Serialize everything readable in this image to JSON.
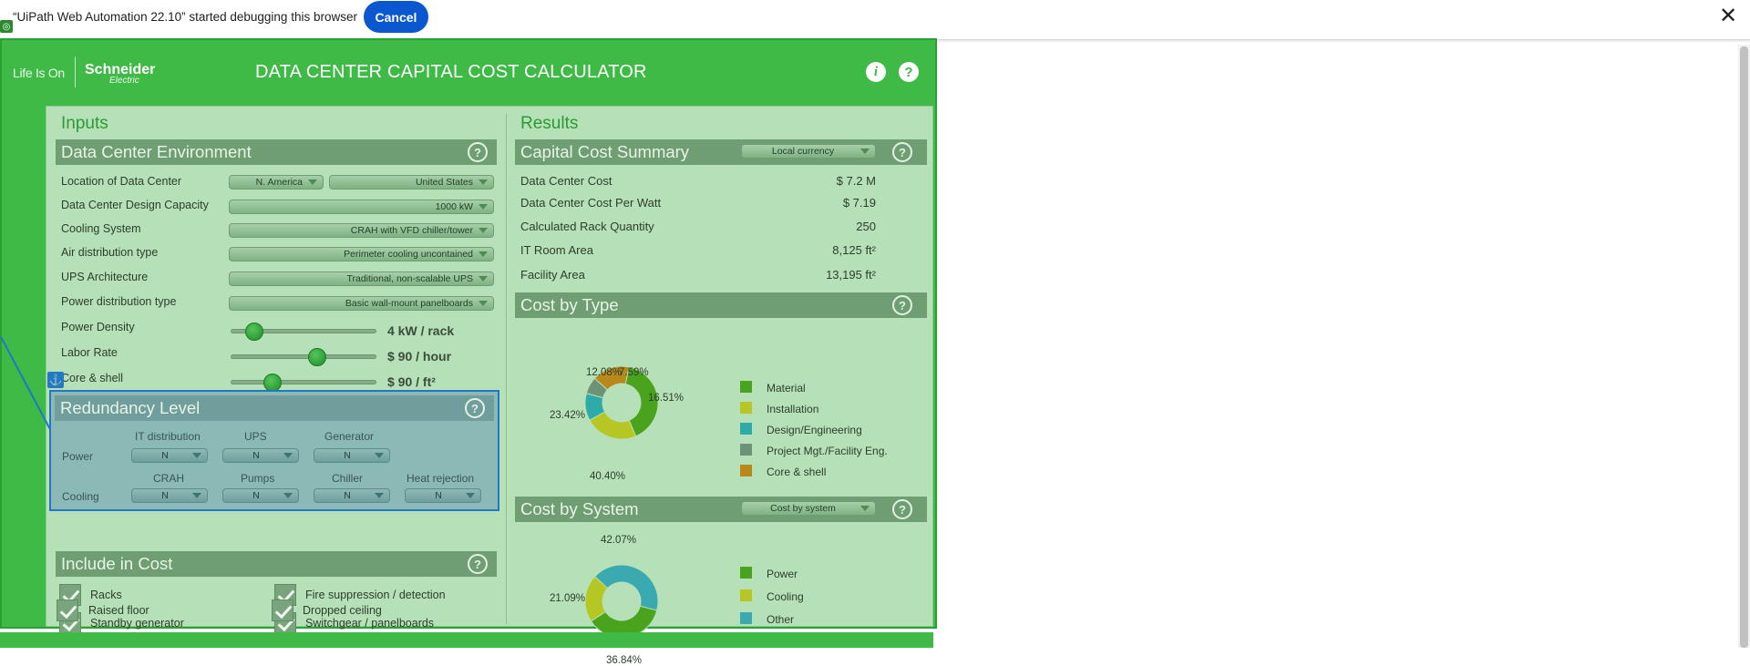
{
  "infobar": {
    "message": "“UiPath Web Automation 22.10” started debugging this browser",
    "cancel_label": "Cancel",
    "close_glyph": "✕"
  },
  "header": {
    "brand_tagline": "Life Is On",
    "brand_name": "Schneider",
    "brand_sub": "Electric",
    "title": "DATA CENTER CAPITAL COST CALCULATOR",
    "info_glyph": "i",
    "help_glyph": "?"
  },
  "inputs": {
    "title": "Inputs",
    "environment": {
      "title": "Data Center Environment",
      "rows": [
        {
          "label": "Location of Data Center",
          "values": [
            "N. America",
            "United States"
          ]
        },
        {
          "label": "Data Center Design Capacity",
          "value": "1000 kW"
        },
        {
          "label": "Cooling System",
          "value": "CRAH with VFD chiller/tower"
        },
        {
          "label": "Air distribution type",
          "value": "Perimeter cooling uncontained"
        },
        {
          "label": "UPS Architecture",
          "value": "Traditional, non-scalable UPS"
        },
        {
          "label": "Power distribution type",
          "value": "Basic wall-mount panelboards"
        }
      ],
      "sliders": [
        {
          "label": "Power Density",
          "value": "4 kW / rack",
          "position": 0.16
        },
        {
          "label": "Labor Rate",
          "value": "$ 90 / hour",
          "position": 0.6
        },
        {
          "label": "Core & shell",
          "value": "$ 90 / ft²",
          "position": 0.3
        }
      ]
    },
    "redundancy": {
      "title": "Redundancy Level",
      "power_label": "Power",
      "cooling_label": "Cooling",
      "power_cols": [
        {
          "label": "IT distribution",
          "value": "N"
        },
        {
          "label": "UPS",
          "value": "N"
        },
        {
          "label": "Generator",
          "value": "N"
        }
      ],
      "cooling_cols": [
        {
          "label": "CRAH",
          "value": "N"
        },
        {
          "label": "Pumps",
          "value": "N"
        },
        {
          "label": "Chiller",
          "value": "N"
        },
        {
          "label": "Heat rejection",
          "value": "N"
        }
      ]
    },
    "include": {
      "title": "Include in Cost",
      "items": [
        {
          "label": "Racks",
          "checked": true
        },
        {
          "label": "Fire suppression / detection",
          "checked": true
        },
        {
          "label": "Standby generator",
          "checked": true
        },
        {
          "label": "Switchgear / panelboards",
          "checked": true
        },
        {
          "label": "Raised floor",
          "checked": true
        },
        {
          "label": "Dropped ceiling",
          "checked": true
        }
      ]
    }
  },
  "results": {
    "title": "Results",
    "summary": {
      "title": "Capital Cost Summary",
      "currency": "Local currency",
      "rows": [
        {
          "label": "Data Center Cost",
          "value": "$ 7.2 M"
        },
        {
          "label": "Data Center Cost Per Watt",
          "value": "$ 7.19"
        },
        {
          "label": "Calculated Rack Quantity",
          "value": "250"
        },
        {
          "label": "IT Room Area",
          "value": "8,125 ft²"
        },
        {
          "label": "Facility Area",
          "value": "13,195 ft²"
        }
      ]
    },
    "by_type": {
      "title": "Cost by Type",
      "legend": [
        "Material",
        "Installation",
        "Design/Engineering",
        "Project Mgt./Facility Eng.",
        "Core & shell"
      ],
      "colors": [
        "#4aa31c",
        "#b6c622",
        "#2eaaa8",
        "#6e9276",
        "#b8891a"
      ],
      "pct_labels": [
        "40.40%",
        "23.42%",
        "12.08%",
        "7.59%",
        "16.51%"
      ]
    },
    "by_system": {
      "title": "Cost by System",
      "selector": "Cost by system",
      "legend": [
        "Power",
        "Cooling",
        "Other"
      ],
      "colors": [
        "#4aa31c",
        "#b6c622",
        "#3aaab0"
      ],
      "pct_labels": [
        "36.84%",
        "21.09%",
        "42.07%"
      ]
    }
  },
  "chart_data": [
    {
      "type": "pie",
      "title": "Cost by Type",
      "categories": [
        "Material",
        "Installation",
        "Design/Engineering",
        "Project Mgt./Facility Eng.",
        "Core & shell"
      ],
      "values": [
        40.4,
        23.42,
        12.08,
        7.59,
        16.51
      ]
    },
    {
      "type": "pie",
      "title": "Cost by System",
      "categories": [
        "Power",
        "Cooling",
        "Other"
      ],
      "values": [
        36.84,
        21.09,
        42.07
      ]
    }
  ]
}
